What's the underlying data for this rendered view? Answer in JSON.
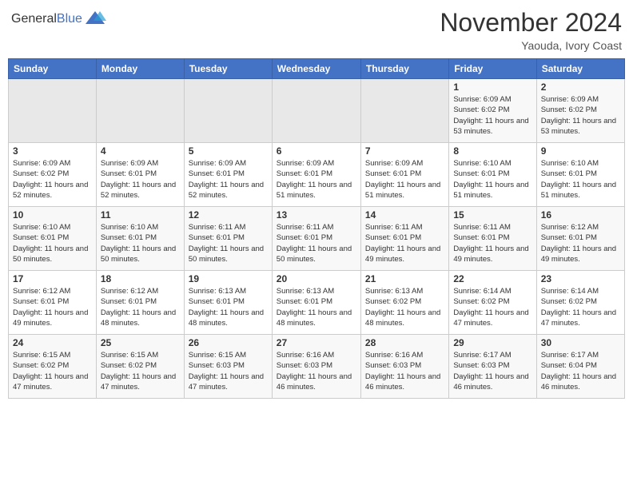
{
  "header": {
    "logo_general": "General",
    "logo_blue": "Blue",
    "month_year": "November 2024",
    "location": "Yaouda, Ivory Coast"
  },
  "weekdays": [
    "Sunday",
    "Monday",
    "Tuesday",
    "Wednesday",
    "Thursday",
    "Friday",
    "Saturday"
  ],
  "weeks": [
    [
      {
        "day": "",
        "empty": true
      },
      {
        "day": "",
        "empty": true
      },
      {
        "day": "",
        "empty": true
      },
      {
        "day": "",
        "empty": true
      },
      {
        "day": "",
        "empty": true
      },
      {
        "day": "1",
        "sunrise": "6:09 AM",
        "sunset": "6:02 PM",
        "daylight": "11 hours and 53 minutes."
      },
      {
        "day": "2",
        "sunrise": "6:09 AM",
        "sunset": "6:02 PM",
        "daylight": "11 hours and 53 minutes."
      }
    ],
    [
      {
        "day": "3",
        "sunrise": "6:09 AM",
        "sunset": "6:02 PM",
        "daylight": "11 hours and 52 minutes."
      },
      {
        "day": "4",
        "sunrise": "6:09 AM",
        "sunset": "6:01 PM",
        "daylight": "11 hours and 52 minutes."
      },
      {
        "day": "5",
        "sunrise": "6:09 AM",
        "sunset": "6:01 PM",
        "daylight": "11 hours and 52 minutes."
      },
      {
        "day": "6",
        "sunrise": "6:09 AM",
        "sunset": "6:01 PM",
        "daylight": "11 hours and 51 minutes."
      },
      {
        "day": "7",
        "sunrise": "6:09 AM",
        "sunset": "6:01 PM",
        "daylight": "11 hours and 51 minutes."
      },
      {
        "day": "8",
        "sunrise": "6:10 AM",
        "sunset": "6:01 PM",
        "daylight": "11 hours and 51 minutes."
      },
      {
        "day": "9",
        "sunrise": "6:10 AM",
        "sunset": "6:01 PM",
        "daylight": "11 hours and 51 minutes."
      }
    ],
    [
      {
        "day": "10",
        "sunrise": "6:10 AM",
        "sunset": "6:01 PM",
        "daylight": "11 hours and 50 minutes."
      },
      {
        "day": "11",
        "sunrise": "6:10 AM",
        "sunset": "6:01 PM",
        "daylight": "11 hours and 50 minutes."
      },
      {
        "day": "12",
        "sunrise": "6:11 AM",
        "sunset": "6:01 PM",
        "daylight": "11 hours and 50 minutes."
      },
      {
        "day": "13",
        "sunrise": "6:11 AM",
        "sunset": "6:01 PM",
        "daylight": "11 hours and 50 minutes."
      },
      {
        "day": "14",
        "sunrise": "6:11 AM",
        "sunset": "6:01 PM",
        "daylight": "11 hours and 49 minutes."
      },
      {
        "day": "15",
        "sunrise": "6:11 AM",
        "sunset": "6:01 PM",
        "daylight": "11 hours and 49 minutes."
      },
      {
        "day": "16",
        "sunrise": "6:12 AM",
        "sunset": "6:01 PM",
        "daylight": "11 hours and 49 minutes."
      }
    ],
    [
      {
        "day": "17",
        "sunrise": "6:12 AM",
        "sunset": "6:01 PM",
        "daylight": "11 hours and 49 minutes."
      },
      {
        "day": "18",
        "sunrise": "6:12 AM",
        "sunset": "6:01 PM",
        "daylight": "11 hours and 48 minutes."
      },
      {
        "day": "19",
        "sunrise": "6:13 AM",
        "sunset": "6:01 PM",
        "daylight": "11 hours and 48 minutes."
      },
      {
        "day": "20",
        "sunrise": "6:13 AM",
        "sunset": "6:01 PM",
        "daylight": "11 hours and 48 minutes."
      },
      {
        "day": "21",
        "sunrise": "6:13 AM",
        "sunset": "6:02 PM",
        "daylight": "11 hours and 48 minutes."
      },
      {
        "day": "22",
        "sunrise": "6:14 AM",
        "sunset": "6:02 PM",
        "daylight": "11 hours and 47 minutes."
      },
      {
        "day": "23",
        "sunrise": "6:14 AM",
        "sunset": "6:02 PM",
        "daylight": "11 hours and 47 minutes."
      }
    ],
    [
      {
        "day": "24",
        "sunrise": "6:15 AM",
        "sunset": "6:02 PM",
        "daylight": "11 hours and 47 minutes."
      },
      {
        "day": "25",
        "sunrise": "6:15 AM",
        "sunset": "6:02 PM",
        "daylight": "11 hours and 47 minutes."
      },
      {
        "day": "26",
        "sunrise": "6:15 AM",
        "sunset": "6:03 PM",
        "daylight": "11 hours and 47 minutes."
      },
      {
        "day": "27",
        "sunrise": "6:16 AM",
        "sunset": "6:03 PM",
        "daylight": "11 hours and 46 minutes."
      },
      {
        "day": "28",
        "sunrise": "6:16 AM",
        "sunset": "6:03 PM",
        "daylight": "11 hours and 46 minutes."
      },
      {
        "day": "29",
        "sunrise": "6:17 AM",
        "sunset": "6:03 PM",
        "daylight": "11 hours and 46 minutes."
      },
      {
        "day": "30",
        "sunrise": "6:17 AM",
        "sunset": "6:04 PM",
        "daylight": "11 hours and 46 minutes."
      }
    ]
  ],
  "labels": {
    "sunrise": "Sunrise:",
    "sunset": "Sunset:",
    "daylight": "Daylight:"
  }
}
